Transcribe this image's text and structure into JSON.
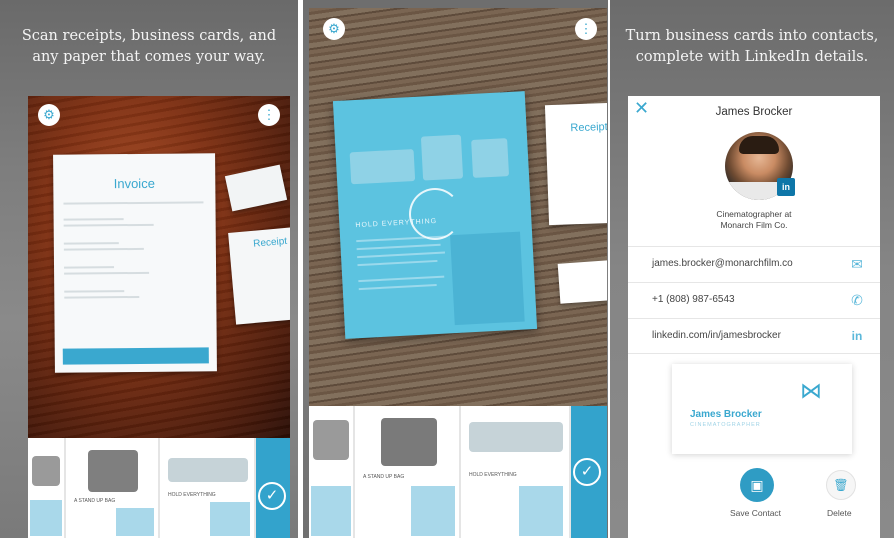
{
  "panel1": {
    "headline_line1": "Scan receipts, business cards, and",
    "headline_line2": "any paper that comes your way.",
    "invoice_title": "Invoice",
    "receipt_title": "Receipt",
    "settings_icon": "gear-icon",
    "more_icon": "more-icon",
    "thumb_captions": [
      "A STAND UP BAG",
      "HOLD EVERYTHING"
    ]
  },
  "panel2": {
    "doc_heading": "HOLD EVERYTHING",
    "receipt_title": "Receipt",
    "thumb_captions": [
      "A STAND UP BAG",
      "HOLD EVERYTHING"
    ]
  },
  "panel3": {
    "headline_line1": "Turn business cards into contacts,",
    "headline_line2": "complete with LinkedIn details.",
    "contact": {
      "name": "James Brocker",
      "title_line1": "Cinematographer at",
      "title_line2": "Monarch Film Co.",
      "linkedin_badge": "in",
      "email": "james.brocker@monarchfilm.co",
      "phone": "+1 (808) 987-6543",
      "linkedin": "linkedin.com/in/jamesbrocker"
    },
    "card_preview": {
      "name": "James Brocker",
      "role": "CINEMATOGRAPHER"
    },
    "actions": {
      "save_label": "Save Contact",
      "delete_label": "Delete"
    }
  },
  "colors": {
    "accent": "#3aa8cf",
    "accent_dark": "#2f9cc4",
    "linkedin": "#0e76a8"
  }
}
